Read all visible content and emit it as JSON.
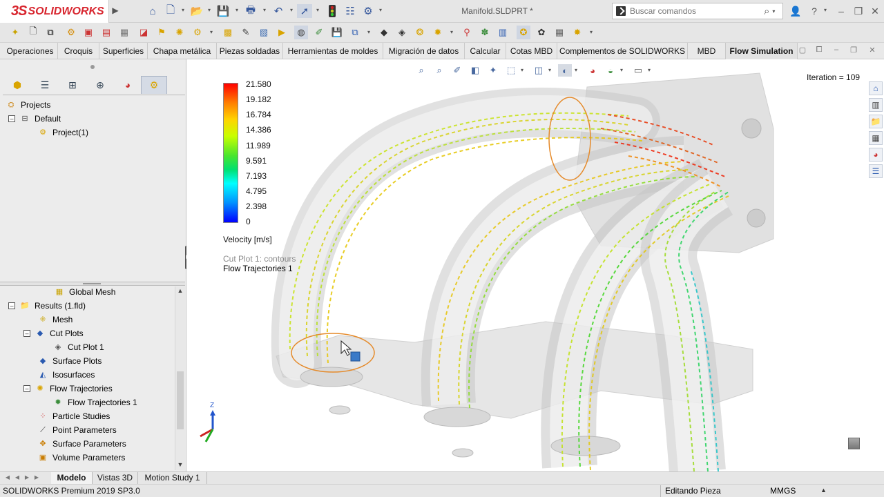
{
  "app": {
    "logo_ds": "3S",
    "logo_name": "SOLIDWORKS",
    "document_title": "Manifold.SLDPRT *"
  },
  "search": {
    "placeholder": "Buscar comandos"
  },
  "tabs": [
    {
      "label": "Operaciones"
    },
    {
      "label": "Croquis"
    },
    {
      "label": "Superficies"
    },
    {
      "label": "Chapa metálica"
    },
    {
      "label": "Piezas soldadas"
    },
    {
      "label": "Herramientas de moldes"
    },
    {
      "label": "Migración de datos"
    },
    {
      "label": "Calcular"
    },
    {
      "label": "Cotas MBD"
    },
    {
      "label": "Complementos de SOLIDWORKS"
    },
    {
      "label": "MBD"
    },
    {
      "label": "Flow Simulation"
    }
  ],
  "project_tree": {
    "root": "Projects",
    "config": "Default",
    "project": "Project(1)"
  },
  "results_tree": [
    {
      "label": "Global Mesh",
      "icon": "mesh-grid-icon"
    },
    {
      "label": "Results (1.fld)",
      "icon": "results-icon"
    },
    {
      "label": "Mesh",
      "icon": "mesh-icon"
    },
    {
      "label": "Cut Plots",
      "icon": "cut-plots-icon"
    },
    {
      "label": "Cut Plot 1",
      "icon": "cut-plot-icon"
    },
    {
      "label": "Surface Plots",
      "icon": "surface-plots-icon"
    },
    {
      "label": "Isosurfaces",
      "icon": "isosurfaces-icon"
    },
    {
      "label": "Flow Trajectories",
      "icon": "flow-trajectories-icon"
    },
    {
      "label": "Flow Trajectories 1",
      "icon": "flow-trajectory-icon"
    },
    {
      "label": "Particle Studies",
      "icon": "particle-studies-icon"
    },
    {
      "label": "Point Parameters",
      "icon": "point-parameters-icon"
    },
    {
      "label": "Surface Parameters",
      "icon": "surface-parameters-icon"
    },
    {
      "label": "Volume Parameters",
      "icon": "volume-parameters-icon"
    }
  ],
  "viewport": {
    "iteration": "Iteration = 109",
    "legend": {
      "values": [
        "21.580",
        "19.182",
        "16.784",
        "14.386",
        "11.989",
        "9.591",
        "7.193",
        "4.795",
        "2.398",
        "0"
      ],
      "title": "Velocity [m/s]",
      "colors": [
        "#ff0000",
        "#ff7f00",
        "#ffd400",
        "#c8ff00",
        "#49e52d",
        "#00e070",
        "#00ffff",
        "#0090ff",
        "#0000ff"
      ]
    },
    "plots": {
      "cut_plot": "Cut Plot 1: contours",
      "trajectories": "Flow Trajectories 1"
    },
    "triad_z": "Z"
  },
  "bottom_tabs": [
    {
      "label": "Modelo"
    },
    {
      "label": "Vistas 3D"
    },
    {
      "label": "Motion Study 1"
    }
  ],
  "status": {
    "product": "SOLIDWORKS Premium 2019 SP3.0",
    "mode": "Editando Pieza",
    "units": "MMGS"
  }
}
